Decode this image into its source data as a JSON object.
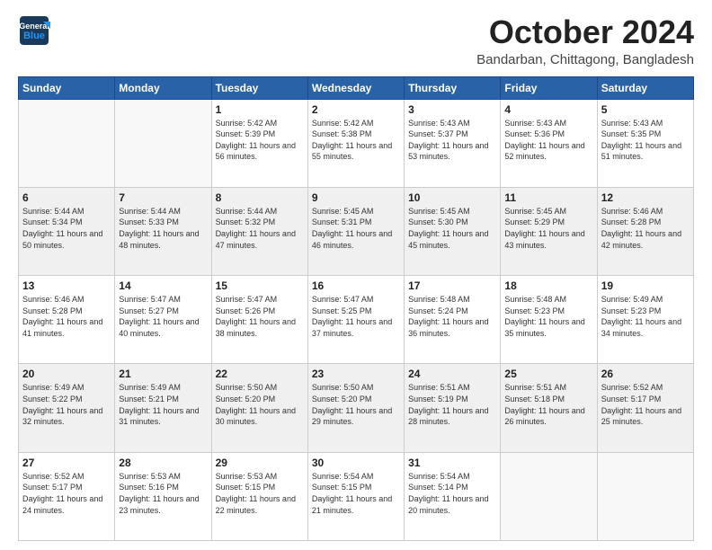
{
  "logo": {
    "general": "General",
    "blue": "Blue"
  },
  "header": {
    "month": "October 2024",
    "location": "Bandarban, Chittagong, Bangladesh"
  },
  "days": [
    "Sunday",
    "Monday",
    "Tuesday",
    "Wednesday",
    "Thursday",
    "Friday",
    "Saturday"
  ],
  "weeks": [
    [
      {
        "day": "",
        "sunrise": "",
        "sunset": "",
        "daylight": ""
      },
      {
        "day": "",
        "sunrise": "",
        "sunset": "",
        "daylight": ""
      },
      {
        "day": "1",
        "sunrise": "Sunrise: 5:42 AM",
        "sunset": "Sunset: 5:39 PM",
        "daylight": "Daylight: 11 hours and 56 minutes."
      },
      {
        "day": "2",
        "sunrise": "Sunrise: 5:42 AM",
        "sunset": "Sunset: 5:38 PM",
        "daylight": "Daylight: 11 hours and 55 minutes."
      },
      {
        "day": "3",
        "sunrise": "Sunrise: 5:43 AM",
        "sunset": "Sunset: 5:37 PM",
        "daylight": "Daylight: 11 hours and 53 minutes."
      },
      {
        "day": "4",
        "sunrise": "Sunrise: 5:43 AM",
        "sunset": "Sunset: 5:36 PM",
        "daylight": "Daylight: 11 hours and 52 minutes."
      },
      {
        "day": "5",
        "sunrise": "Sunrise: 5:43 AM",
        "sunset": "Sunset: 5:35 PM",
        "daylight": "Daylight: 11 hours and 51 minutes."
      }
    ],
    [
      {
        "day": "6",
        "sunrise": "Sunrise: 5:44 AM",
        "sunset": "Sunset: 5:34 PM",
        "daylight": "Daylight: 11 hours and 50 minutes."
      },
      {
        "day": "7",
        "sunrise": "Sunrise: 5:44 AM",
        "sunset": "Sunset: 5:33 PM",
        "daylight": "Daylight: 11 hours and 48 minutes."
      },
      {
        "day": "8",
        "sunrise": "Sunrise: 5:44 AM",
        "sunset": "Sunset: 5:32 PM",
        "daylight": "Daylight: 11 hours and 47 minutes."
      },
      {
        "day": "9",
        "sunrise": "Sunrise: 5:45 AM",
        "sunset": "Sunset: 5:31 PM",
        "daylight": "Daylight: 11 hours and 46 minutes."
      },
      {
        "day": "10",
        "sunrise": "Sunrise: 5:45 AM",
        "sunset": "Sunset: 5:30 PM",
        "daylight": "Daylight: 11 hours and 45 minutes."
      },
      {
        "day": "11",
        "sunrise": "Sunrise: 5:45 AM",
        "sunset": "Sunset: 5:29 PM",
        "daylight": "Daylight: 11 hours and 43 minutes."
      },
      {
        "day": "12",
        "sunrise": "Sunrise: 5:46 AM",
        "sunset": "Sunset: 5:28 PM",
        "daylight": "Daylight: 11 hours and 42 minutes."
      }
    ],
    [
      {
        "day": "13",
        "sunrise": "Sunrise: 5:46 AM",
        "sunset": "Sunset: 5:28 PM",
        "daylight": "Daylight: 11 hours and 41 minutes."
      },
      {
        "day": "14",
        "sunrise": "Sunrise: 5:47 AM",
        "sunset": "Sunset: 5:27 PM",
        "daylight": "Daylight: 11 hours and 40 minutes."
      },
      {
        "day": "15",
        "sunrise": "Sunrise: 5:47 AM",
        "sunset": "Sunset: 5:26 PM",
        "daylight": "Daylight: 11 hours and 38 minutes."
      },
      {
        "day": "16",
        "sunrise": "Sunrise: 5:47 AM",
        "sunset": "Sunset: 5:25 PM",
        "daylight": "Daylight: 11 hours and 37 minutes."
      },
      {
        "day": "17",
        "sunrise": "Sunrise: 5:48 AM",
        "sunset": "Sunset: 5:24 PM",
        "daylight": "Daylight: 11 hours and 36 minutes."
      },
      {
        "day": "18",
        "sunrise": "Sunrise: 5:48 AM",
        "sunset": "Sunset: 5:23 PM",
        "daylight": "Daylight: 11 hours and 35 minutes."
      },
      {
        "day": "19",
        "sunrise": "Sunrise: 5:49 AM",
        "sunset": "Sunset: 5:23 PM",
        "daylight": "Daylight: 11 hours and 34 minutes."
      }
    ],
    [
      {
        "day": "20",
        "sunrise": "Sunrise: 5:49 AM",
        "sunset": "Sunset: 5:22 PM",
        "daylight": "Daylight: 11 hours and 32 minutes."
      },
      {
        "day": "21",
        "sunrise": "Sunrise: 5:49 AM",
        "sunset": "Sunset: 5:21 PM",
        "daylight": "Daylight: 11 hours and 31 minutes."
      },
      {
        "day": "22",
        "sunrise": "Sunrise: 5:50 AM",
        "sunset": "Sunset: 5:20 PM",
        "daylight": "Daylight: 11 hours and 30 minutes."
      },
      {
        "day": "23",
        "sunrise": "Sunrise: 5:50 AM",
        "sunset": "Sunset: 5:20 PM",
        "daylight": "Daylight: 11 hours and 29 minutes."
      },
      {
        "day": "24",
        "sunrise": "Sunrise: 5:51 AM",
        "sunset": "Sunset: 5:19 PM",
        "daylight": "Daylight: 11 hours and 28 minutes."
      },
      {
        "day": "25",
        "sunrise": "Sunrise: 5:51 AM",
        "sunset": "Sunset: 5:18 PM",
        "daylight": "Daylight: 11 hours and 26 minutes."
      },
      {
        "day": "26",
        "sunrise": "Sunrise: 5:52 AM",
        "sunset": "Sunset: 5:17 PM",
        "daylight": "Daylight: 11 hours and 25 minutes."
      }
    ],
    [
      {
        "day": "27",
        "sunrise": "Sunrise: 5:52 AM",
        "sunset": "Sunset: 5:17 PM",
        "daylight": "Daylight: 11 hours and 24 minutes."
      },
      {
        "day": "28",
        "sunrise": "Sunrise: 5:53 AM",
        "sunset": "Sunset: 5:16 PM",
        "daylight": "Daylight: 11 hours and 23 minutes."
      },
      {
        "day": "29",
        "sunrise": "Sunrise: 5:53 AM",
        "sunset": "Sunset: 5:15 PM",
        "daylight": "Daylight: 11 hours and 22 minutes."
      },
      {
        "day": "30",
        "sunrise": "Sunrise: 5:54 AM",
        "sunset": "Sunset: 5:15 PM",
        "daylight": "Daylight: 11 hours and 21 minutes."
      },
      {
        "day": "31",
        "sunrise": "Sunrise: 5:54 AM",
        "sunset": "Sunset: 5:14 PM",
        "daylight": "Daylight: 11 hours and 20 minutes."
      },
      {
        "day": "",
        "sunrise": "",
        "sunset": "",
        "daylight": ""
      },
      {
        "day": "",
        "sunrise": "",
        "sunset": "",
        "daylight": ""
      }
    ]
  ]
}
